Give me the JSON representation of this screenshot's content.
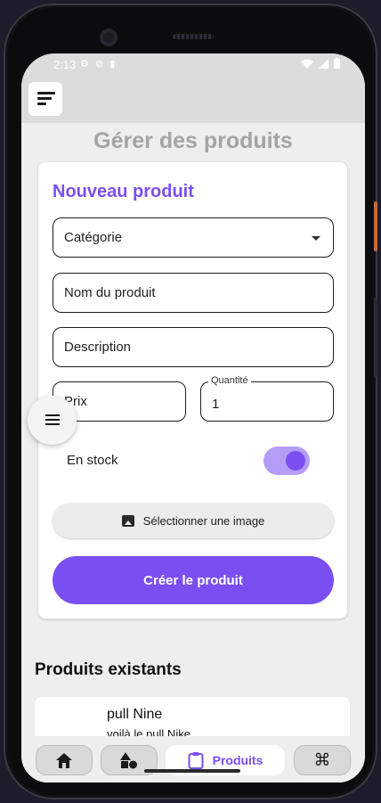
{
  "status_bar": {
    "time": "2:13"
  },
  "page": {
    "title": "Gérer des produits"
  },
  "form": {
    "title": "Nouveau produit",
    "category_label": "Catégorie",
    "name_placeholder": "Nom du produit",
    "description_placeholder": "Description",
    "price_placeholder": "Prix",
    "quantity_label": "Quantité",
    "quantity_value": "1",
    "stock_label": "En stock",
    "stock_on": true,
    "image_button": "Sélectionner une image",
    "submit_button": "Créer le produit"
  },
  "products": {
    "title": "Produits existants",
    "items": [
      {
        "name": "pull Nine",
        "description": "voilà le pull Nike"
      }
    ]
  },
  "bottom_nav": {
    "items": [
      {
        "icon": "home-icon"
      },
      {
        "icon": "shapes-icon"
      },
      {
        "icon": "clipboard-icon",
        "label": "Produits"
      },
      {
        "icon": "command-icon"
      }
    ]
  },
  "colors": {
    "accent": "#7a4ff2",
    "toggle_track": "#b59cf7",
    "title_gray": "#a4a4a4"
  }
}
